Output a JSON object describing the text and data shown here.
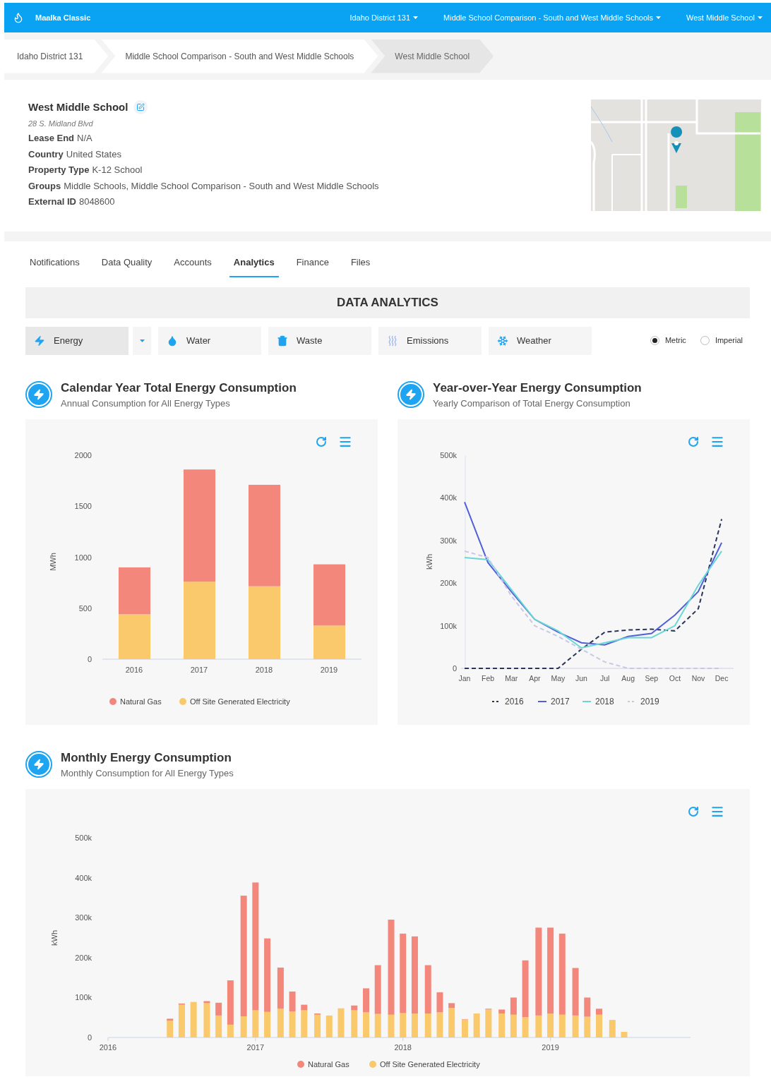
{
  "app": {
    "name": "Maalka Classic",
    "nav": [
      "Idaho District 131",
      "Middle School Comparison - South and West Middle Schools",
      "West Middle School"
    ]
  },
  "breadcrumbs": [
    {
      "label": "Idaho District 131",
      "selected": false
    },
    {
      "label": "Middle School Comparison - South and West Middle Schools",
      "selected": false
    },
    {
      "label": "West Middle School",
      "selected": true
    }
  ],
  "property": {
    "name": "West Middle School",
    "address": "28 S. Midland Blvd",
    "fields": [
      {
        "label": "Lease End",
        "value": "N/A"
      },
      {
        "label": "Country",
        "value": "United States"
      },
      {
        "label": "Property Type",
        "value": "K-12 School"
      },
      {
        "label": "Groups",
        "value": "Middle Schools, Middle School Comparison - South and West Middle Schools"
      },
      {
        "label": "External ID",
        "value": "8048600"
      }
    ]
  },
  "tabs": [
    {
      "label": "Notifications",
      "selected": false
    },
    {
      "label": "Data Quality",
      "selected": false
    },
    {
      "label": "Accounts",
      "selected": false
    },
    {
      "label": "Analytics",
      "selected": true
    },
    {
      "label": "Finance",
      "selected": false
    },
    {
      "label": "Files",
      "selected": false
    }
  ],
  "analytics": {
    "title": "DATA ANALYTICS",
    "categories": [
      {
        "label": "Energy",
        "kind": "energy",
        "selected": true
      },
      {
        "label": "Water",
        "kind": "water",
        "selected": false
      },
      {
        "label": "Waste",
        "kind": "waste",
        "selected": false
      },
      {
        "label": "Emissions",
        "kind": "emissions",
        "selected": false
      },
      {
        "label": "Weather",
        "kind": "weather",
        "selected": false
      }
    ],
    "units": [
      {
        "label": "Metric",
        "selected": true
      },
      {
        "label": "Imperial",
        "selected": false
      }
    ]
  },
  "charts": [
    {
      "title": "Calendar Year Total Energy Consumption",
      "subtitle": "Annual Consumption for All Energy Types",
      "chart_data": {
        "type": "bar",
        "stacked": true,
        "legend": true,
        "ylabel": "MWh",
        "categories": [
          "2016",
          "2017",
          "2018",
          "2019"
        ],
        "ylim": [
          0,
          2000
        ],
        "yticks": [
          0,
          500,
          1000,
          1500,
          2000
        ],
        "series": [
          {
            "name": "Natural Gas",
            "color": "#f4877c",
            "values": [
              460,
              1100,
              995,
              600
            ]
          },
          {
            "name": "Off Site Generated Electricity",
            "color": "#f9c96b",
            "values": [
              440,
              760,
              715,
              330
            ]
          }
        ]
      }
    },
    {
      "title": "Year-over-Year Energy Consumption",
      "subtitle": "Yearly Comparison of Total Energy Consumption",
      "chart_data": {
        "type": "line",
        "legend": true,
        "ylabel": "kWh",
        "categories": [
          "Jan",
          "Feb",
          "Mar",
          "Apr",
          "May",
          "Jun",
          "Jul",
          "Aug",
          "Sep",
          "Oct",
          "Nov",
          "Dec"
        ],
        "ylim": [
          0,
          500000
        ],
        "yticks": [
          {
            "value": 0,
            "label": "0"
          },
          {
            "value": 100000,
            "label": "100k"
          },
          {
            "value": 200000,
            "label": "200k"
          },
          {
            "value": 300000,
            "label": "300k"
          },
          {
            "value": 400000,
            "label": "400k"
          },
          {
            "value": 500000,
            "label": "500k"
          }
        ],
        "series": [
          {
            "name": "2016",
            "color": "#2a3558",
            "line_style": "dashed",
            "values": [
              0,
              0,
              0,
              0,
              0,
              45000,
              85000,
              90000,
              92000,
              88000,
              140000,
              350000
            ]
          },
          {
            "name": "2017",
            "color": "#5060d8",
            "line_style": "solid",
            "values": [
              390000,
              248000,
              180000,
              115000,
              85000,
              60000,
              55000,
              75000,
              82000,
              125000,
              180000,
              295000
            ]
          },
          {
            "name": "2018",
            "color": "#6ad7d6",
            "line_style": "solid",
            "values": [
              260000,
              255000,
              185000,
              115000,
              88000,
              48000,
              60000,
              72000,
              72000,
              100000,
              195000,
              275000
            ]
          },
          {
            "name": "2019",
            "color": "#c8c8e6",
            "line_style": "dashed",
            "values": [
              275000,
              260000,
              170000,
              100000,
              75000,
              45000,
              15000,
              0,
              0,
              0,
              0,
              0
            ]
          }
        ]
      }
    },
    {
      "title": "Monthly Energy Consumption",
      "subtitle": "Monthly Consumption for All Energy Types",
      "chart_data": {
        "type": "bar",
        "stacked": true,
        "legend": true,
        "ylabel": "kWh",
        "xlim": [
          2016,
          2019.95
        ],
        "xticks": [
          2016,
          2017,
          2018,
          2019
        ],
        "ylim": [
          0,
          500000
        ],
        "yticks": [
          {
            "value": 0,
            "label": "0"
          },
          {
            "value": 100000,
            "label": "100k"
          },
          {
            "value": 200000,
            "label": "200k"
          },
          {
            "value": 300000,
            "label": "300k"
          },
          {
            "value": 400000,
            "label": "400k"
          },
          {
            "value": 500000,
            "label": "500k"
          }
        ],
        "x": [
          2016.42,
          2016.5,
          2016.58,
          2016.67,
          2016.75,
          2016.83,
          2016.92,
          2017,
          2017.08,
          2017.17,
          2017.25,
          2017.33,
          2017.42,
          2017.5,
          2017.58,
          2017.67,
          2017.75,
          2017.83,
          2017.92,
          2018,
          2018.08,
          2018.17,
          2018.25,
          2018.33,
          2018.42,
          2018.5,
          2018.58,
          2018.67,
          2018.75,
          2018.83,
          2018.92,
          2019,
          2019.08,
          2019.17,
          2019.25,
          2019.33,
          2019.42,
          2019.5
        ],
        "series": [
          {
            "name": "Natural Gas",
            "color": "#f4877c",
            "values": [
              5000,
              3000,
              0,
              5000,
              32000,
              111000,
              302000,
              320000,
              184000,
              103000,
              50000,
              14000,
              3000,
              0,
              0,
              12000,
              60000,
              122000,
              238000,
              199000,
              193000,
              121000,
              50000,
              12000,
              1000,
              0,
              2000,
              10000,
              43000,
              142000,
              220000,
              215000,
              203000,
              119000,
              48000,
              15000,
              0,
              0
            ]
          },
          {
            "name": "Off Site Generated Electricity",
            "color": "#f9c96b",
            "values": [
              42000,
              82000,
              89000,
              86000,
              55000,
              32000,
              53000,
              68000,
              64000,
              72000,
              65000,
              68000,
              57000,
              55000,
              73000,
              68000,
              63000,
              59000,
              57000,
              61000,
              60000,
              60000,
              63000,
              74000,
              45000,
              60000,
              70000,
              60000,
              57000,
              51000,
              55000,
              60000,
              57000,
              55000,
              52000,
              57000,
              44000,
              14000
            ]
          }
        ]
      }
    }
  ]
}
